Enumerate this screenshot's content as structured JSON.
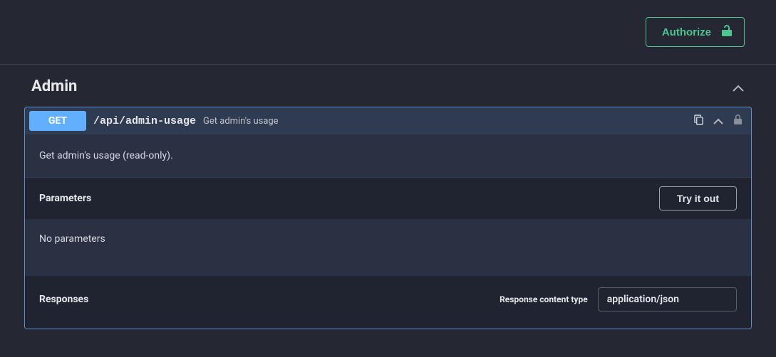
{
  "authorize": {
    "label": "Authorize"
  },
  "section": {
    "title": "Admin"
  },
  "operation": {
    "method": "GET",
    "path": "/api/admin-usage",
    "summary": "Get admin's usage",
    "description": "Get admin's usage (read-only)."
  },
  "parameters": {
    "title": "Parameters",
    "try_label": "Try it out",
    "empty": "No parameters"
  },
  "responses": {
    "title": "Responses",
    "content_type_label": "Response content type",
    "content_type_value": "application/json"
  }
}
